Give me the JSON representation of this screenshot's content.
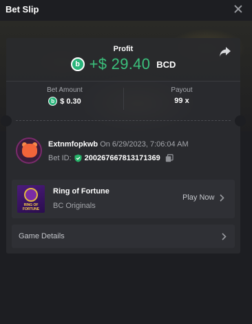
{
  "header": {
    "title": "Bet Slip",
    "close_icon": "close-icon"
  },
  "profit": {
    "label": "Profit",
    "value": "+$ 29.40",
    "currency": "BCD",
    "coin_glyph": "b",
    "color": "#3bc17c"
  },
  "stats": {
    "bet_amount_label": "Bet Amount",
    "bet_amount_value": "$ 0.30",
    "payout_label": "Payout",
    "payout_value": "99 x"
  },
  "user": {
    "name": "Extnmfopkwb",
    "timestamp": "On 6/29/2023, 7:06:04 AM",
    "bet_id_label": "Bet ID:",
    "bet_id": "200267667813171369"
  },
  "game": {
    "name": "Ring of Fortune",
    "provider": "BC Originals",
    "thumb_text": "RING OF FORTUNE",
    "play_label": "Play Now"
  },
  "details": {
    "label": "Game Details"
  },
  "colors": {
    "background": "#1d1e22",
    "card": "#2a2b30",
    "accent_green": "#3bc17c",
    "muted_text": "#a5a7ac"
  }
}
